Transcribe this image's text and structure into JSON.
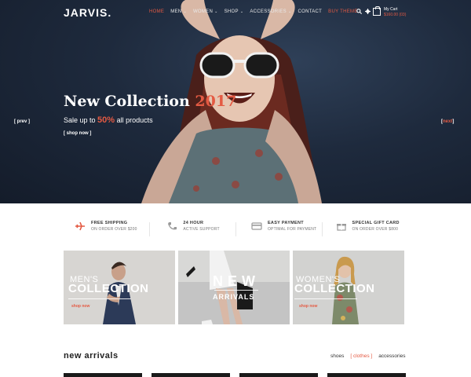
{
  "header": {
    "logo": "JARVIS.",
    "nav": [
      {
        "label": "HOME",
        "active": true
      },
      {
        "label": "MEN",
        "dropdown": true
      },
      {
        "label": "WOMEN",
        "dropdown": true
      },
      {
        "label": "SHOP",
        "dropdown": true
      },
      {
        "label": "ACCESSORIES",
        "dropdown": true
      },
      {
        "label": "CONTACT"
      },
      {
        "label": "BUY THEME",
        "highlight": true
      }
    ],
    "cart": {
      "label": "My Cart",
      "total": "$160.00 (03)"
    },
    "icons": [
      "search-icon",
      "gear-icon",
      "cart-icon"
    ]
  },
  "hero": {
    "title_main": "New Collection",
    "title_year": "2017",
    "subtitle_pre": "Sale up to",
    "subtitle_pct": "50%",
    "subtitle_post": "all products",
    "cta": "[ shop now ]",
    "prev": "[ prev ]",
    "next_open": "[",
    "next_word": "next",
    "next_close": "]"
  },
  "features": [
    {
      "icon": "airplane-icon",
      "title": "FREE SHIPPING",
      "subtitle": "ON ORDER OVER $200"
    },
    {
      "icon": "phone-icon",
      "title": "24 HOUR",
      "subtitle": "ACTIVE SUPPORT"
    },
    {
      "icon": "credit-card-icon",
      "title": "EASY PAYMENT",
      "subtitle": "OPTIMAL FOR PAYMENT"
    },
    {
      "icon": "gift-icon",
      "title": "SPECIAL GIFT CARD",
      "subtitle": "ON ORDER OVER $800"
    }
  ],
  "banners": [
    {
      "line1": "MEN'S",
      "line2": "COLLECTION",
      "shop": "shop now"
    },
    {
      "line1": "NEW",
      "line2": "ARRIVALS"
    },
    {
      "line1": "WOMEN'S",
      "line2": "COLLECTION",
      "shop": "shop now"
    }
  ],
  "new_arrivals": {
    "title": "new arrivals",
    "filters": [
      {
        "label": "shoes"
      },
      {
        "label": "[ clothes ]",
        "active": true
      },
      {
        "label": "accessories"
      }
    ]
  },
  "colors": {
    "accent": "#e45a43",
    "hero_bg": "#1e2a3d"
  }
}
